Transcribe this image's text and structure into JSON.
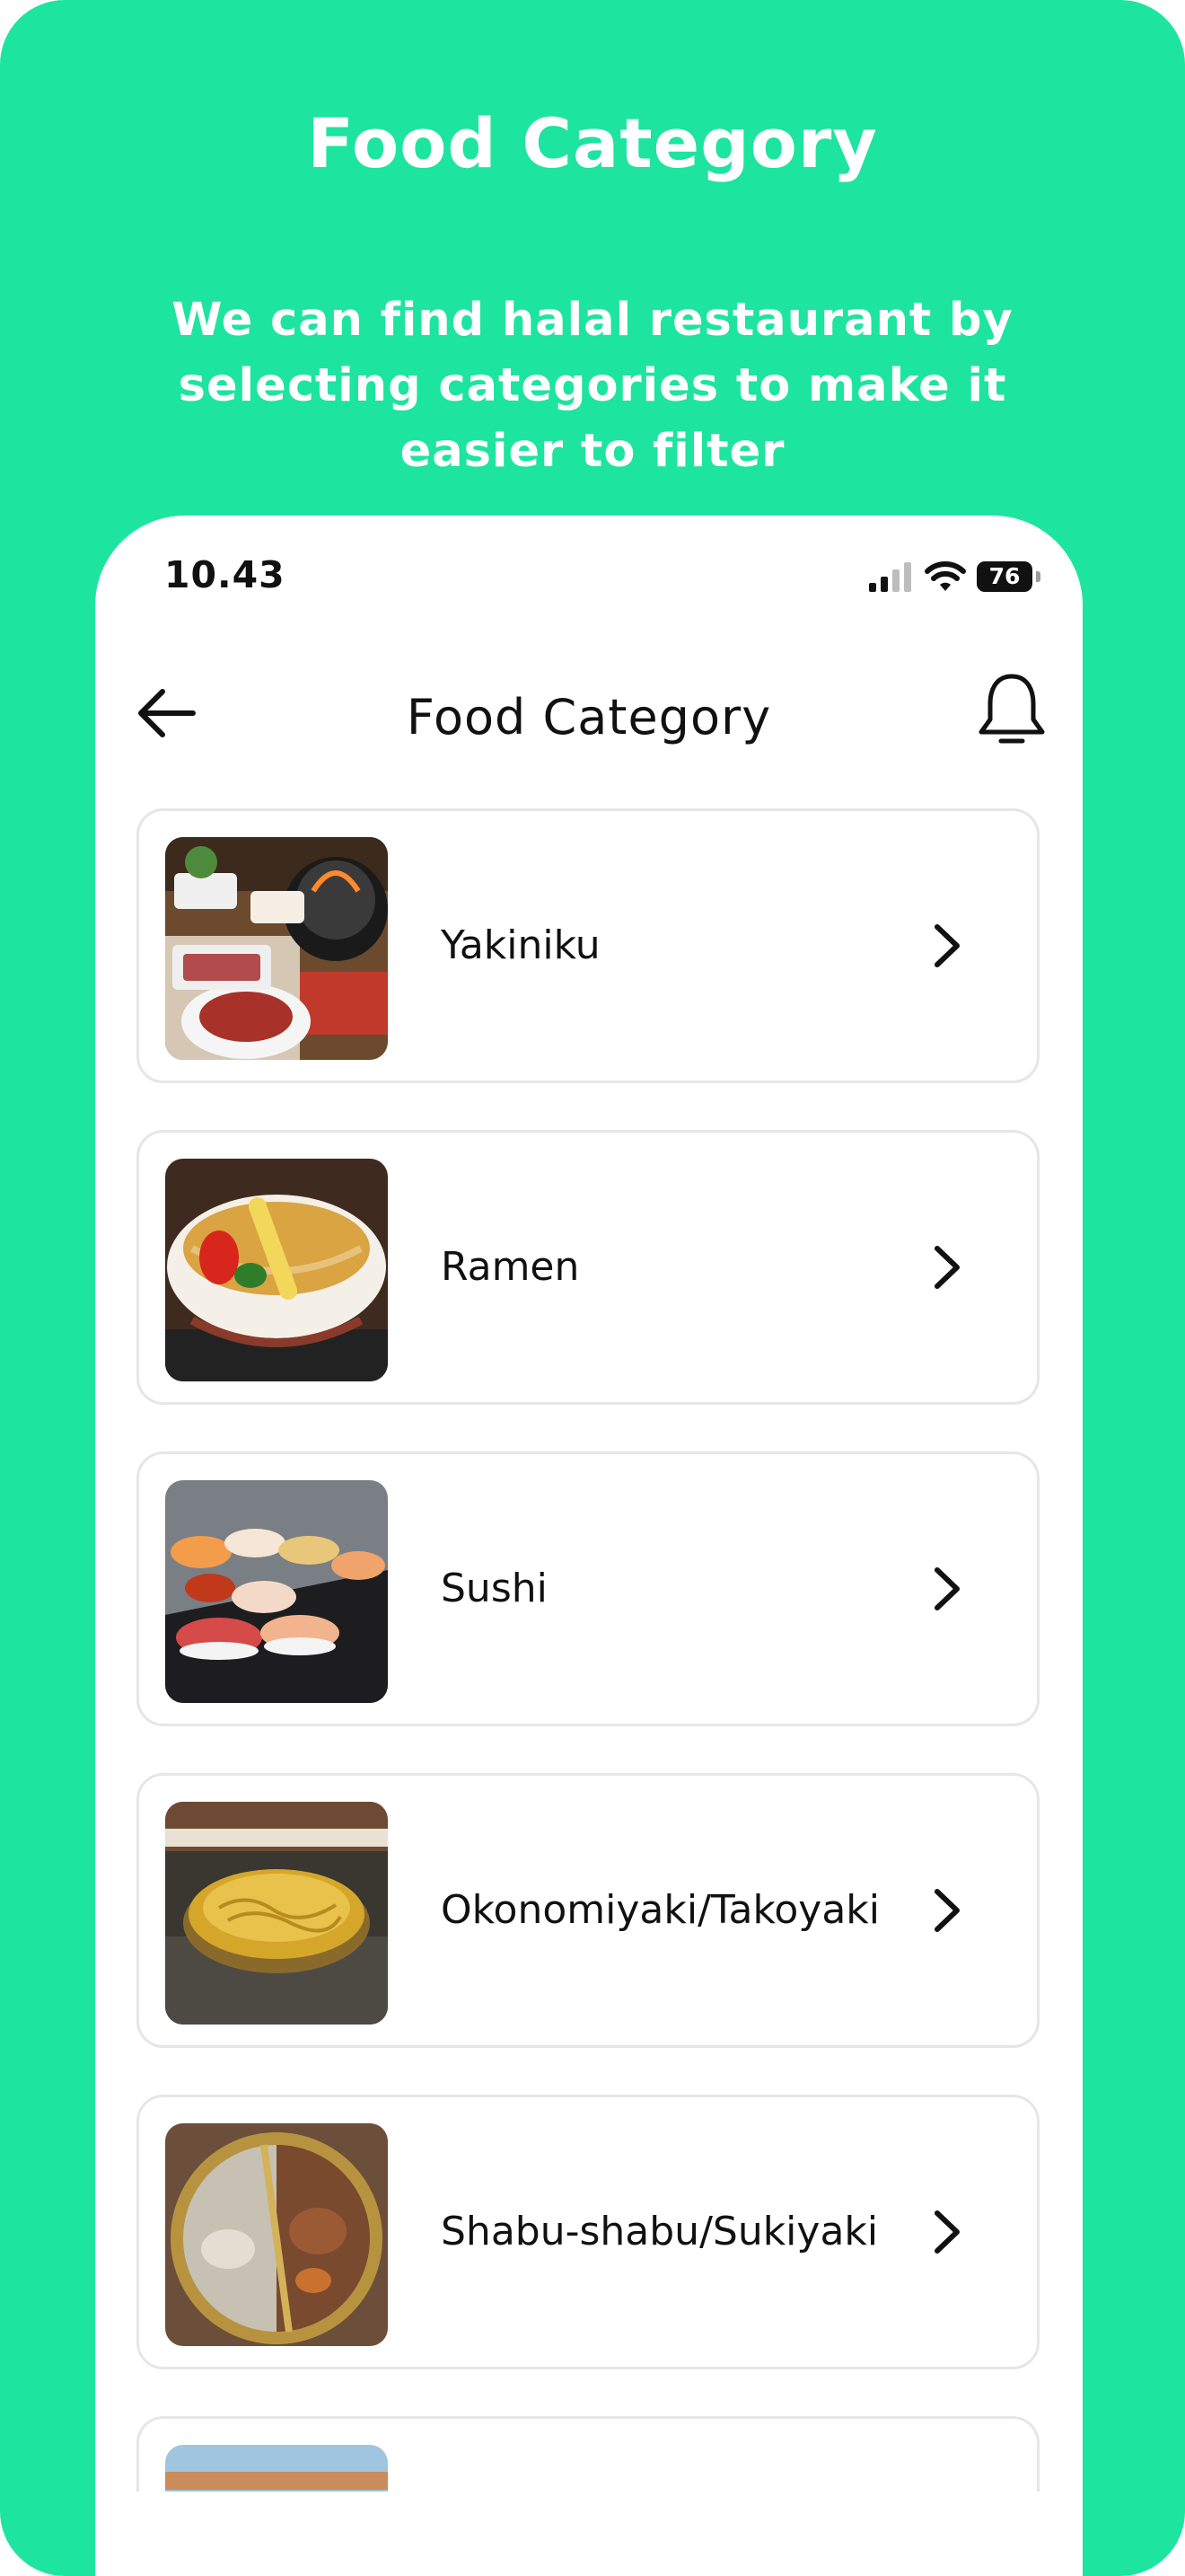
{
  "promo": {
    "title": "Food Category",
    "subtitle": "We can find halal restaurant by selecting categories to make it easier to filter"
  },
  "status_bar": {
    "time": "10.43",
    "battery": "76",
    "icons": [
      "signal-icon",
      "wifi-icon",
      "battery-icon"
    ]
  },
  "nav": {
    "title": "Food Category",
    "back_icon": "arrow-left-icon",
    "notification_icon": "bell-icon"
  },
  "categories": [
    {
      "label": "Yakiniku",
      "image": "yakiniku-photo"
    },
    {
      "label": "Ramen",
      "image": "ramen-photo"
    },
    {
      "label": "Sushi",
      "image": "sushi-photo"
    },
    {
      "label": "Okonomiyaki/Takoyaki",
      "image": "okonomiyaki-photo"
    },
    {
      "label": "Shabu-shabu/Sukiyaki",
      "image": "shabu-shabu-photo"
    },
    {
      "label": "",
      "image": "partial-photo"
    }
  ],
  "colors": {
    "background": "#1de49f",
    "surface": "#ffffff",
    "text": "#111111",
    "card_border": "#e6e6e6"
  }
}
